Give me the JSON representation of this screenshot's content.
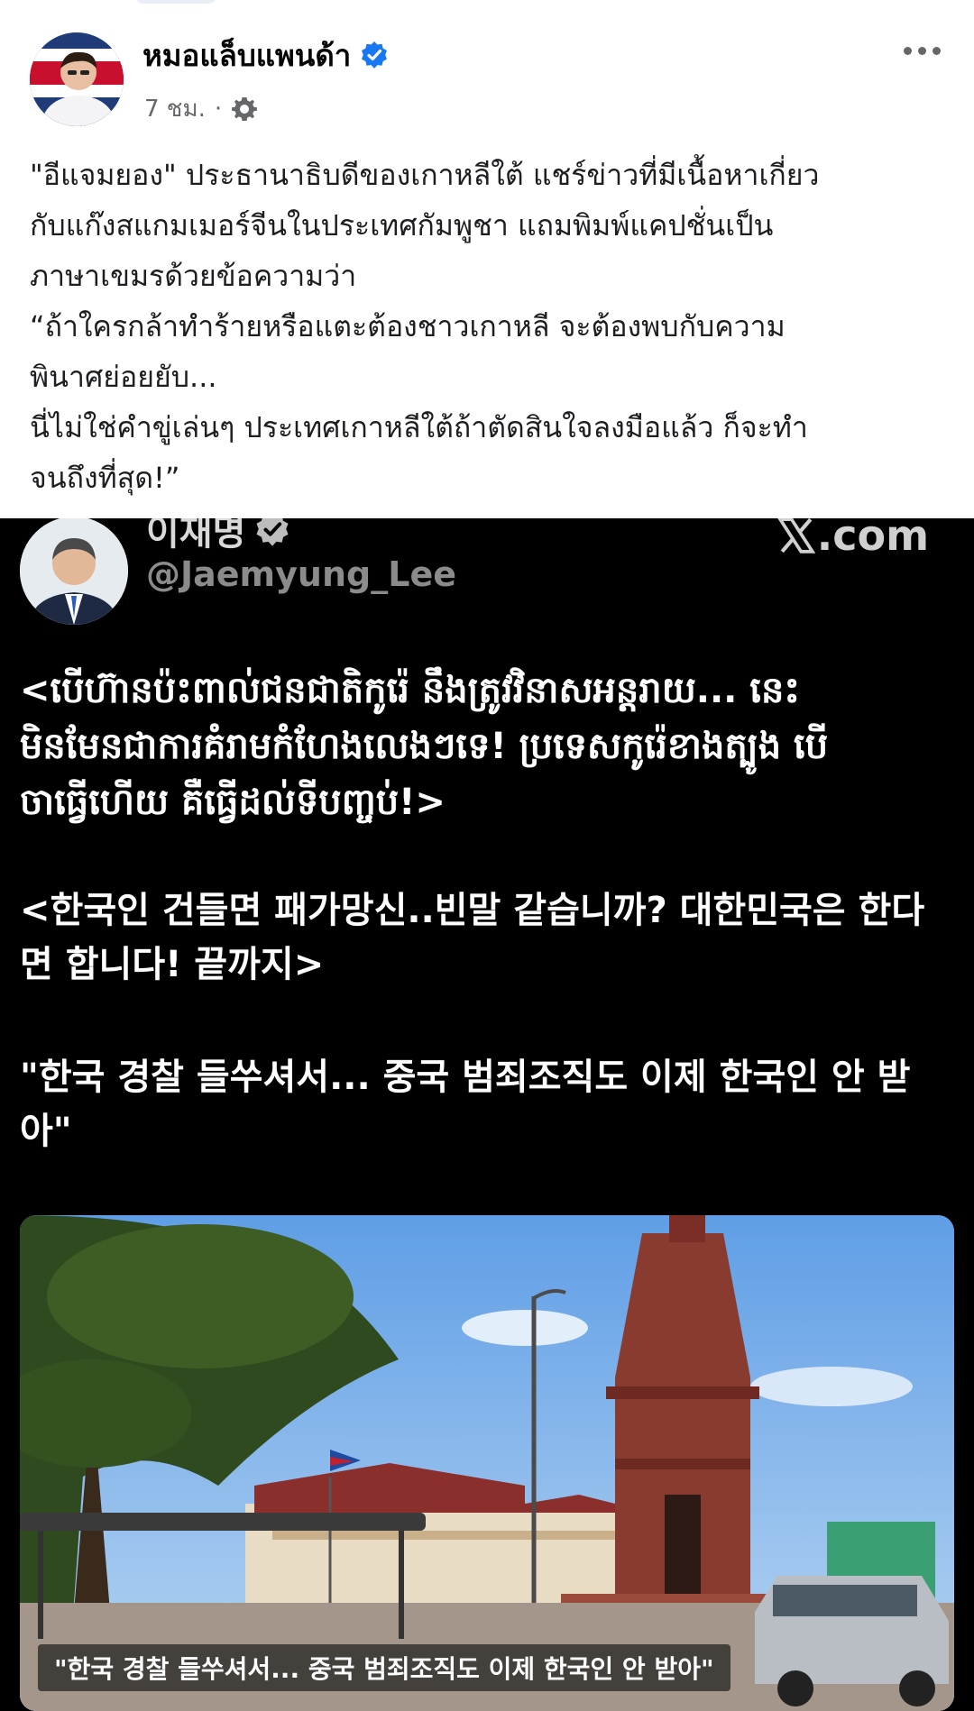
{
  "post": {
    "author_name": "หมอแล็บแพนด้า",
    "time": "7 ชม.",
    "separator": "·",
    "audience_icon": "gear-icon",
    "verified_icon": "verified-badge-icon",
    "more_icon": "more-options-icon",
    "text": "\"อีแจมยอง\" ประธานาธิบดีของเกาหลีใต้ แชร์ข่าวที่มีเนื้อหาเกี่ยว\nกับแก๊งสแกมเมอร์จีนในประเทศกัมพูชา แถมพิมพ์แคปชั่นเป็น\nภาษาเขมรด้วยข้อความว่า\n“ถ้าใครกล้าทำร้ายหรือแตะต้องชาวเกาหลี จะต้องพบกับความ\nพินาศย่อยยับ...\nนี่ไม่ใช่คำขู่เล่นๆ ประเทศเกาหลีใต้ถ้าตัดสินใจลงมือแล้ว ก็จะทำ\nจนถึงที่สุด!”"
  },
  "tweet": {
    "name": "이재명",
    "handle": "@Jaemyung_Lee",
    "brand": ".com",
    "brand_icon": "x-logo-icon",
    "khmer_text": "<បើហ៊ានប៉ះពាល់ជនជាតិកូរ៉េ នឹងត្រូវវិនាសអន្តរាយ... នេះ\nមិនមែនជាការគំរាមកំហែងលេងៗទេ! ប្រទេសកូរ៉េខាងត្បូង បើ\nចាធ្វើហើយ គឺធ្វើដល់ទីបញ្ចប់!>",
    "korean_text_1": "<한국인 건들면 패가망신..빈말 같습니까? 대한민국은 한다\n면 합니다! 끝까지>",
    "korean_text_2": "\"한국 경찰 들쑤셔서... 중국 범죄조직도 이제 한국인 안 받\n아\"",
    "photo_caption": "\"한국 경찰 들쑤셔서... 중국 범죄조직도 이제 한국인 안 받아\""
  },
  "colors": {
    "facebook_verified": "#1877f2",
    "post_text": "#1c1e21",
    "meta_text": "#65676b",
    "tweet_background": "#000000"
  }
}
